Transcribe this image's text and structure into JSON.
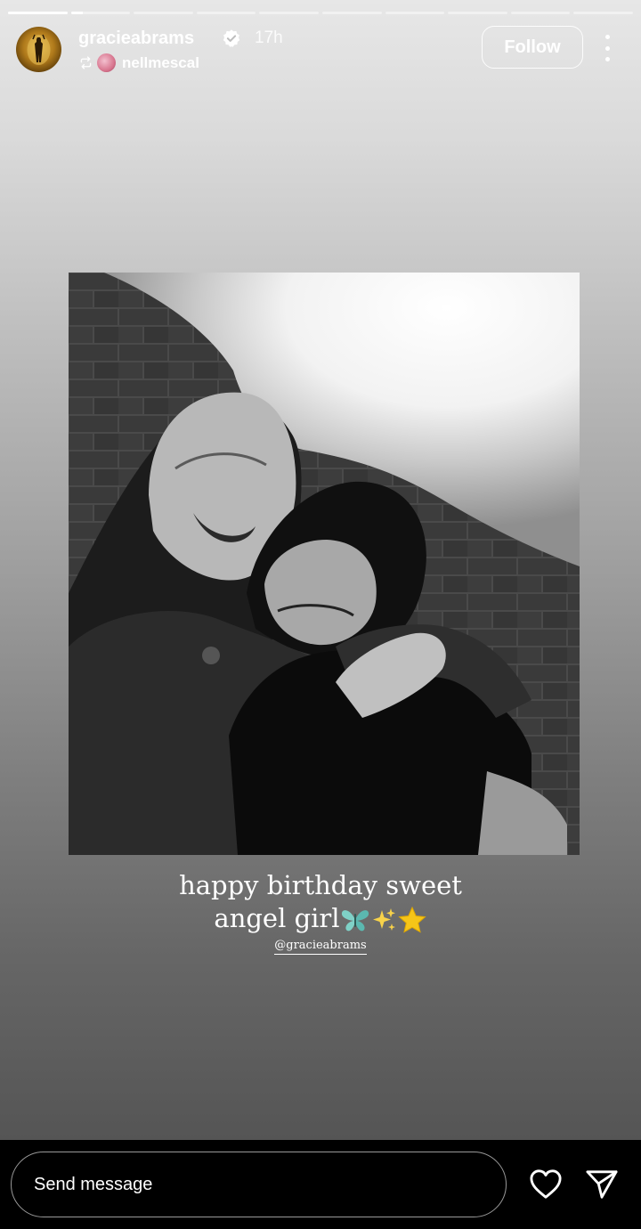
{
  "story": {
    "progress": [
      1,
      0.2,
      0,
      0,
      0,
      0,
      0,
      0,
      0,
      0
    ],
    "author": {
      "username": "gracieabrams",
      "verified": true,
      "time": "17h"
    },
    "repost": {
      "username": "nellmescal"
    },
    "follow_label": "Follow",
    "caption_line1": "happy birthday sweet",
    "caption_line2": "angel girl",
    "caption_emojis": [
      "butterfly",
      "sparkles",
      "star"
    ],
    "mention": "@gracieabrams"
  },
  "reply_bar": {
    "placeholder": "Send message"
  },
  "colors": {
    "background_top": "#e7e7e7",
    "background_bottom": "#555555",
    "text": "#ffffff",
    "bar": "#000000"
  }
}
